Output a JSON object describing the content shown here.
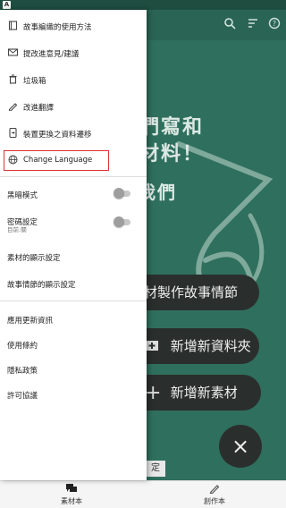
{
  "status_bar": {
    "indicator": "A"
  },
  "background_app": {
    "headline_lines": [
      "我們寫和",
      "存材料！",
      "讓我們"
    ],
    "pills": [
      {
        "icon": "",
        "label": "素材製作故事情節"
      },
      {
        "icon": "plus-box-icon",
        "label": "新增新資料夾"
      },
      {
        "icon": "plus-icon",
        "label": "新增新素材"
      }
    ],
    "fab_label": "×",
    "chip_label": "定"
  },
  "drawer": {
    "top_items": [
      {
        "icon": "book-icon",
        "label": "故事編織的使用方法"
      },
      {
        "icon": "mail-icon",
        "label": "提改進意見/建議"
      },
      {
        "icon": "trash-icon",
        "label": "垃圾箱"
      },
      {
        "icon": "pencil-icon",
        "label": "改進翻譯"
      },
      {
        "icon": "transfer-icon",
        "label": "裝置更換之資料遷移"
      },
      {
        "icon": "globe-icon",
        "label": "Change Language"
      }
    ],
    "settings": {
      "dark_mode_label": "黑暗模式",
      "password_label": "密碼設定",
      "password_sub": "目前:關",
      "material_display_label": "素材的顯示設定",
      "story_display_label": "故事情節的顯示設定"
    },
    "footer_items": [
      {
        "label": "應用更新資訊"
      },
      {
        "label": "使用條約"
      },
      {
        "label": "隱私政策"
      },
      {
        "label": "許可協議"
      }
    ]
  },
  "bottom_nav": {
    "items": [
      {
        "icon": "chat-icon",
        "label": "素材本"
      },
      {
        "icon": "pen-icon",
        "label": "創作本"
      }
    ]
  },
  "colors": {
    "background_green": "#2f6f5d",
    "highlight_red": "#dd3333",
    "drawer_bg": "#ffffff"
  }
}
